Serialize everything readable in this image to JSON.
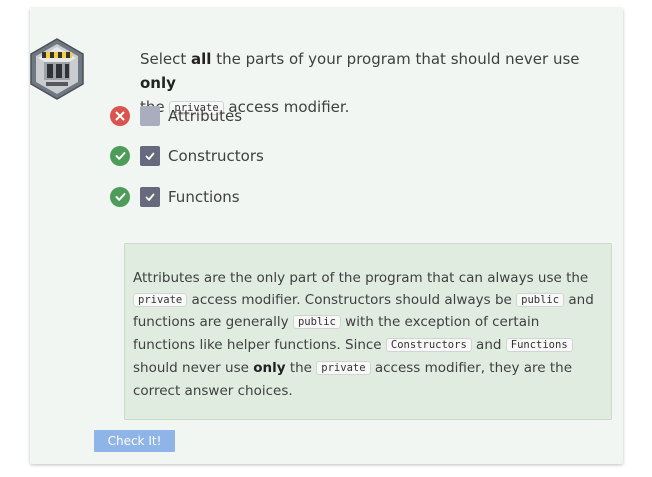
{
  "question": {
    "part1": "Select ",
    "bold1": "all",
    "part2": " the parts of your program that should never use ",
    "bold2": "only",
    "part3": "the ",
    "code1": "private",
    "part4": " access modifier."
  },
  "options": [
    {
      "label": "Attributes",
      "status": "incorrect",
      "checked": false
    },
    {
      "label": "Constructors",
      "status": "correct",
      "checked": true
    },
    {
      "label": "Functions",
      "status": "correct",
      "checked": true
    }
  ],
  "feedback": {
    "t1": "Attributes are the only part of the program that can always use the ",
    "c1": "private",
    "t2": " access modifier. Constructors should always be ",
    "c2": "public",
    "t3": " and functions are generally ",
    "c3": "public",
    "t4": " with the exception of certain functions like helper functions. Since ",
    "c4": "Constructors",
    "t5": " and ",
    "c5": "Functions",
    "t6": " should never use ",
    "b1": "only",
    "t7": " the ",
    "c6": "private",
    "t8": " access modifier, they are the correct answer choices."
  },
  "check_button": {
    "label": "Check It!"
  },
  "colors": {
    "incorrect": "#d9534f",
    "correct": "#4e9c5a",
    "button": "#8fb4e8"
  }
}
